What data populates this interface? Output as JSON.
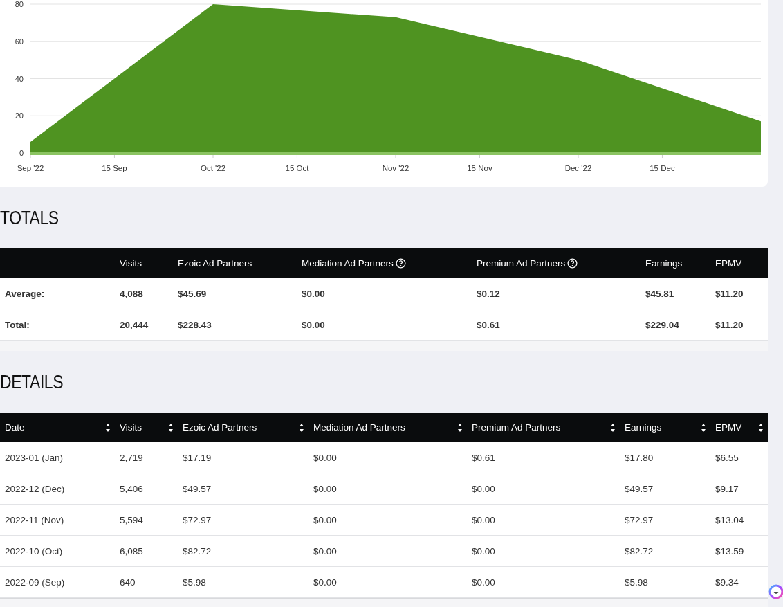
{
  "chart": {
    "mid_month_labels": [
      "15 Sep",
      "15 Oct",
      "15 Nov",
      "15 Dec"
    ],
    "chart_data": {
      "type": "area",
      "categories": [
        "Sep '22",
        "Oct '22",
        "Nov '22",
        "Dec '22",
        null
      ],
      "yticks": [
        0,
        20,
        40,
        60,
        80
      ],
      "ylim": [
        0,
        80
      ],
      "grid": true,
      "series": [
        {
          "color": "#4f9321",
          "values": [
            6,
            80,
            73,
            50,
            17
          ]
        }
      ]
    }
  },
  "totals": {
    "title": "TOTALS",
    "columns": [
      {
        "help": false
      },
      {
        "label": "Visits",
        "help": false
      },
      {
        "label": "Ezoic Ad Partners",
        "help": false
      },
      {
        "label": "Mediation Ad Partners",
        "help": true
      },
      {
        "label": "Premium Ad Partners",
        "help": true
      },
      {
        "label": "Earnings",
        "help": false
      },
      {
        "label": "EPMV",
        "help": false
      }
    ],
    "rows": [
      [
        "Average:",
        "4,088",
        "$45.69",
        "$0.00",
        "$0.12",
        "$45.81",
        "$11.20"
      ],
      [
        "Total:",
        "20,444",
        "$228.43",
        "$0.00",
        "$0.61",
        "$229.04",
        "$11.20"
      ]
    ]
  },
  "details": {
    "title": "DETAILS",
    "columns": [
      "Date",
      "Visits",
      "Ezoic Ad Partners",
      "Mediation Ad Partners",
      "Premium Ad Partners",
      "Earnings",
      "EPMV"
    ],
    "rows": [
      [
        "2023-01 (Jan)",
        "2,719",
        "$17.19",
        "$0.00",
        "$0.61",
        "$17.80",
        "$6.55"
      ],
      [
        "2022-12 (Dec)",
        "5,406",
        "$49.57",
        "$0.00",
        "$0.00",
        "$49.57",
        "$9.17"
      ],
      [
        "2022-11 (Nov)",
        "5,594",
        "$72.97",
        "$0.00",
        "$0.00",
        "$72.97",
        "$13.04"
      ],
      [
        "2022-10 (Oct)",
        "6,085",
        "$82.72",
        "$0.00",
        "$0.00",
        "$82.72",
        "$13.59"
      ],
      [
        "2022-09 (Sep)",
        "640",
        "$5.98",
        "$0.00",
        "$0.00",
        "$5.98",
        "$9.34"
      ]
    ]
  }
}
